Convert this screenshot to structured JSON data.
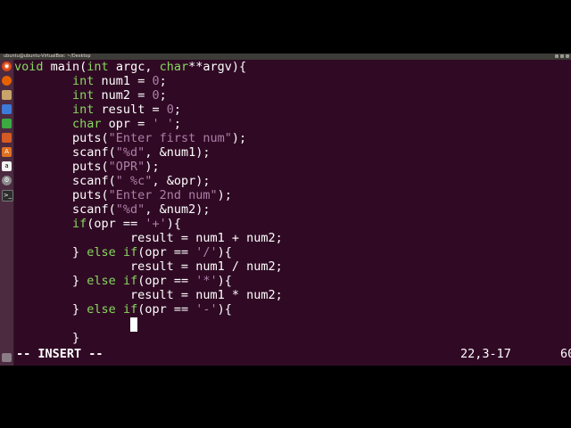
{
  "window": {
    "title": "ubuntu@ubuntu-VirtualBox: ~/Desktop"
  },
  "launcher": {
    "icons": [
      "ubuntu-dash-icon",
      "firefox-icon",
      "files-icon",
      "writer-icon",
      "calc-icon",
      "impress-icon",
      "software-center-icon",
      "amazon-icon",
      "settings-icon",
      "terminal-icon",
      "trash-icon"
    ]
  },
  "code": {
    "lines": [
      "void main(int argc, char**argv){",
      "        int num1 = 0;",
      "        int num2 = 0;",
      "        int result = 0;",
      "        char opr = ' ';",
      "        puts(\"Enter first num\");",
      "        scanf(\"%d\", &num1);",
      "        puts(\"OPR\");",
      "        scanf(\" %c\", &opr);",
      "        puts(\"Enter 2nd num\");",
      "        scanf(\"%d\", &num2);",
      "        if(opr == '+'){",
      "                result = num1 + num2;",
      "        } else if(opr == '/'){",
      "                result = num1 / num2;",
      "        } else if(opr == '*'){",
      "                result = num1 * num2;",
      "        } else if(opr == '-'){",
      "",
      "        }"
    ]
  },
  "status": {
    "mode": "-- INSERT --",
    "position": "22,3-17",
    "scroll": "60"
  }
}
